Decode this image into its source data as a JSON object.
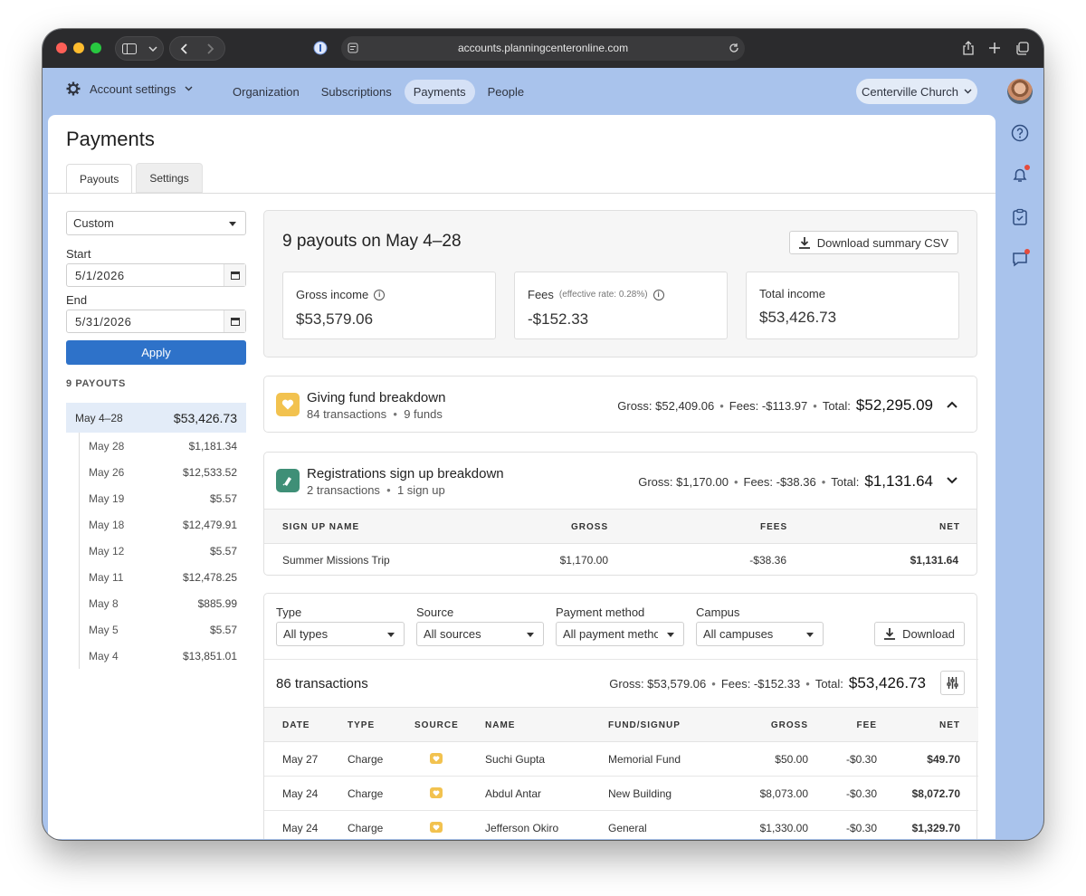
{
  "browser": {
    "url": "accounts.planningcenteronline.com"
  },
  "appbar": {
    "account_settings": "Account settings",
    "nav": [
      "Organization",
      "Subscriptions",
      "Payments",
      "People"
    ],
    "active_nav": "Payments",
    "church": "Centerville Church"
  },
  "page": {
    "title": "Payments",
    "tabs": [
      "Payouts",
      "Settings"
    ]
  },
  "filters": {
    "range": "Custom",
    "start_label": "Start",
    "start_value": "5/1/2026",
    "end_label": "End",
    "end_value": "5/31/2026",
    "apply": "Apply"
  },
  "payouts": {
    "heading": "9 PAYOUTS",
    "selected": {
      "label": "May 4–28",
      "amount": "$53,426.73"
    },
    "items": [
      {
        "date": "May 28",
        "amount": "$1,181.34"
      },
      {
        "date": "May 26",
        "amount": "$12,533.52"
      },
      {
        "date": "May 19",
        "amount": "$5.57"
      },
      {
        "date": "May 18",
        "amount": "$12,479.91"
      },
      {
        "date": "May 12",
        "amount": "$5.57"
      },
      {
        "date": "May 11",
        "amount": "$12,478.25"
      },
      {
        "date": "May 8",
        "amount": "$885.99"
      },
      {
        "date": "May 5",
        "amount": "$5.57"
      },
      {
        "date": "May 4",
        "amount": "$13,851.01"
      }
    ]
  },
  "summary": {
    "title": "9 payouts on May 4–28",
    "download": "Download summary CSV",
    "gross_label": "Gross income",
    "gross_value": "$53,579.06",
    "fees_label": "Fees",
    "fees_note": "(effective rate: 0.28%)",
    "fees_value": "-$152.33",
    "total_label": "Total income",
    "total_value": "$53,426.73"
  },
  "giving": {
    "title": "Giving fund breakdown",
    "transactions": "84 transactions",
    "funds": "9 funds",
    "gross": "Gross: $52,409.06",
    "fees": "Fees: -$113.97",
    "total_label": "Total:",
    "total": "$52,295.09"
  },
  "registrations": {
    "title": "Registrations sign up breakdown",
    "transactions": "2 transactions",
    "signups": "1 sign up",
    "gross": "Gross: $1,170.00",
    "fees": "Fees: -$38.36",
    "total_label": "Total:",
    "total": "$1,131.64",
    "columns": [
      "SIGN UP NAME",
      "GROSS",
      "FEES",
      "NET"
    ],
    "rows": [
      {
        "name": "Summer Missions Trip",
        "gross": "$1,170.00",
        "fees": "-$38.36",
        "net": "$1,131.64"
      }
    ]
  },
  "transactions": {
    "filters": [
      {
        "label": "Type",
        "value": "All types"
      },
      {
        "label": "Source",
        "value": "All sources"
      },
      {
        "label": "Payment method",
        "value": "All payment methods"
      },
      {
        "label": "Campus",
        "value": "All campuses"
      }
    ],
    "download": "Download",
    "count": "86 transactions",
    "gross": "Gross: $53,579.06",
    "fees": "Fees: -$152.33",
    "total_label": "Total:",
    "total": "$53,426.73",
    "columns": [
      "DATE",
      "TYPE",
      "SOURCE",
      "NAME",
      "FUND/SIGNUP",
      "GROSS",
      "FEE",
      "NET"
    ],
    "rows": [
      {
        "date": "May 27",
        "type": "Charge",
        "source": "giving-icon",
        "name": "Suchi Gupta",
        "fund": "Memorial Fund",
        "gross": "$50.00",
        "fee": "-$0.30",
        "net": "$49.70"
      },
      {
        "date": "May 24",
        "type": "Charge",
        "source": "giving-icon",
        "name": "Abdul Antar",
        "fund": "New Building",
        "gross": "$8,073.00",
        "fee": "-$0.30",
        "net": "$8,072.70"
      },
      {
        "date": "May 24",
        "type": "Charge",
        "source": "giving-icon",
        "name": "Jefferson Okiro",
        "fund": "General",
        "gross": "$1,330.00",
        "fee": "-$0.30",
        "net": "$1,329.70"
      }
    ]
  },
  "colors": {
    "accent": "#2e72c9",
    "header_bg": "#a9c3ec",
    "giving_icon": "#f2c24f",
    "registrations_icon": "#3f8f77"
  }
}
